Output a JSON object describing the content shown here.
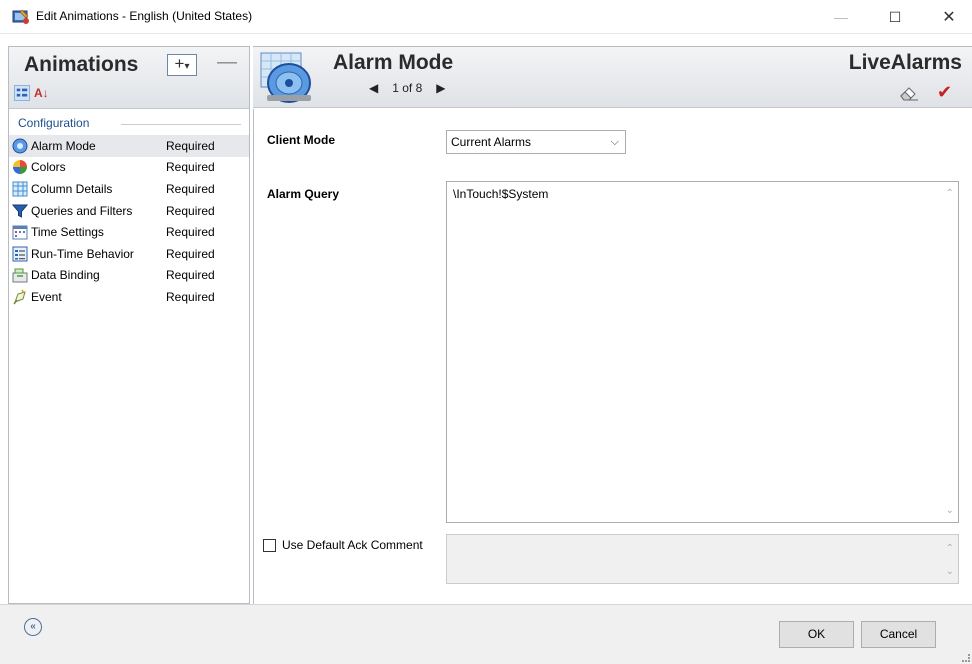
{
  "window": {
    "title": "Edit Animations - English (United States)",
    "min_glyph": "—",
    "max_glyph": "☐",
    "close_glyph": "✕"
  },
  "left_panel": {
    "heading": "Animations",
    "add_glyph": "+",
    "add_dropdown_glyph": "▾",
    "remove_glyph": "—",
    "sort_az_glyph": "A↓",
    "group_label": "Configuration",
    "items": [
      {
        "label": "Alarm Mode",
        "status": "Required",
        "icon": "alarm-mode-icon",
        "color": "#3b7fd1",
        "selected": true
      },
      {
        "label": "Colors",
        "status": "Required",
        "icon": "colors-icon",
        "color": "#e89a2c"
      },
      {
        "label": "Column Details",
        "status": "Required",
        "icon": "column-details-icon",
        "color": "#3d8fd6"
      },
      {
        "label": "Queries and Filters",
        "status": "Required",
        "icon": "filter-icon",
        "color": "#1e4d9c"
      },
      {
        "label": "Time Settings",
        "status": "Required",
        "icon": "calendar-icon",
        "color": "#d24040"
      },
      {
        "label": "Run-Time Behavior",
        "status": "Required",
        "icon": "behavior-icon",
        "color": "#2e63b3"
      },
      {
        "label": "Data Binding",
        "status": "Required",
        "icon": "data-binding-icon",
        "color": "#4f9a3a"
      },
      {
        "label": "Event",
        "status": "Required",
        "icon": "event-icon",
        "color": "#6f8f2f"
      }
    ]
  },
  "header": {
    "title": "Alarm Mode",
    "prev_glyph": "◀",
    "next_glyph": "▶",
    "pager": "1 of 8",
    "object_name": "LiveAlarms",
    "check_glyph": "✔"
  },
  "form": {
    "client_mode_label": "Client Mode",
    "client_mode_value": "Current Alarms",
    "select_chevron": "⌵",
    "alarm_query_label": "Alarm Query",
    "alarm_query_value": "\\InTouch!$System",
    "scroll_up_glyph": "⌃",
    "scroll_down_glyph": "⌄",
    "ack_comment_label": "Use Default Ack Comment",
    "ack_comment_value": ""
  },
  "footer": {
    "collapse_glyph": "«",
    "ok_label": "OK",
    "cancel_label": "Cancel"
  },
  "colors": {
    "accent": "#1f4e8f",
    "header_gradient_top": "#f3f4f6",
    "header_gradient_bottom": "#dfe2e6",
    "check_red": "#c82020"
  }
}
